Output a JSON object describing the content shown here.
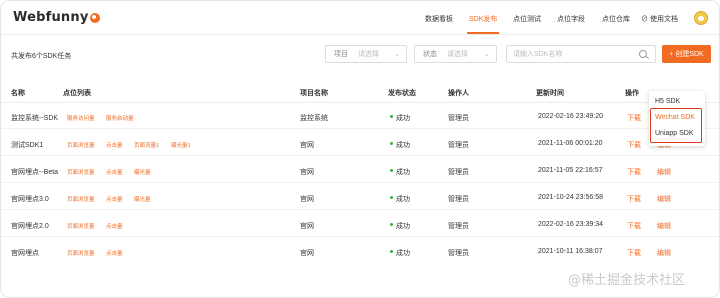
{
  "app": {
    "logo_text": "Webfunny"
  },
  "nav": [
    {
      "label": "数据看板",
      "active": false
    },
    {
      "label": "SDK发布",
      "active": true
    },
    {
      "label": "点位测试",
      "active": false
    },
    {
      "label": "点位字段",
      "active": false
    },
    {
      "label": "点位仓库",
      "active": false
    },
    {
      "label": "使用文档",
      "active": false
    }
  ],
  "toolbar": {
    "count_text": "共发布6个SDK任务",
    "project_label": "项目",
    "project_value": "请选择",
    "status_label": "状态",
    "status_value": "请选择",
    "search_placeholder": "请输入SDK名称",
    "create_label": "+ 创建SDK"
  },
  "table": {
    "headers": {
      "name": "名称",
      "points": "点位列表",
      "project": "项目名称",
      "status": "发布状态",
      "operator": "操作人",
      "updated": "更新时间",
      "actions": "操作"
    },
    "rows": [
      {
        "name": "监控系统--SDK",
        "tags": [
          "服务访问量",
          "服务启动量"
        ],
        "project": "监控系统",
        "status": "成功",
        "operator": "管理员",
        "updated": "2022-02-16 23:49:20",
        "download": "下载",
        "edit": ""
      },
      {
        "name": "测试SDK1",
        "tags": [
          "页面浏览量",
          "点击量",
          "页面流量1",
          "曝光量1"
        ],
        "project": "官网",
        "status": "成功",
        "operator": "管理员",
        "updated": "2021-11-06 00:01:20",
        "download": "下载",
        "edit": "编辑"
      },
      {
        "name": "官网埋点--Beta",
        "tags": [
          "页面浏览量",
          "点击量",
          "曝光量"
        ],
        "project": "官网",
        "status": "成功",
        "operator": "管理员",
        "updated": "2021-11-05 22:16:57",
        "download": "下载",
        "edit": "编辑"
      },
      {
        "name": "官网埋点3.0",
        "tags": [
          "页面浏览量",
          "点击量",
          "曝光量"
        ],
        "project": "官网",
        "status": "成功",
        "operator": "管理员",
        "updated": "2021-10-24 23:56:58",
        "download": "下载",
        "edit": "编辑"
      },
      {
        "name": "官网埋点2.0",
        "tags": [
          "页面浏览量",
          "点击量"
        ],
        "project": "官网",
        "status": "成功",
        "operator": "管理员",
        "updated": "2022-02-16 23:39:34",
        "download": "下载",
        "edit": "编辑"
      },
      {
        "name": "官网埋点",
        "tags": [
          "页面浏览量",
          "点击量"
        ],
        "project": "官网",
        "status": "成功",
        "operator": "管理员",
        "updated": "2021-10-11 16:38:07",
        "download": "下载",
        "edit": "编辑"
      }
    ]
  },
  "sdk_menu": {
    "items": [
      "H5 SDK",
      "Wechat SDK",
      "Uniapp SDK"
    ],
    "highlight_color": "#e03a1e"
  },
  "watermark": "@稀土掘金技术社区",
  "colors": {
    "accent": "#f26b22",
    "success": "#3ab54a"
  }
}
